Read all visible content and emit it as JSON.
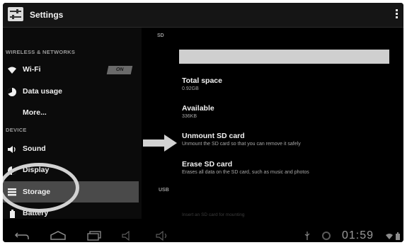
{
  "app": {
    "title": "Settings"
  },
  "left_panel": {
    "sections": {
      "wireless": "WIRELESS & NETWORKS",
      "device": "DEVICE"
    },
    "items": [
      {
        "label": "Wi-Fi",
        "toggle": "ON"
      },
      {
        "label": "Data usage"
      },
      {
        "label": "More..."
      },
      {
        "label": "Sound"
      },
      {
        "label": "Display"
      },
      {
        "label": "Storage",
        "selected": true
      },
      {
        "label": "Battery"
      }
    ]
  },
  "right_panel": {
    "sd_header": "SD",
    "usb_header": "USB",
    "total_space": {
      "title": "Total space",
      "value": "0.92GB"
    },
    "available": {
      "title": "Available",
      "value": "336KB"
    },
    "unmount": {
      "title": "Unmount SD card",
      "summary": "Unmount the SD card so that you can remove it safely"
    },
    "erase": {
      "title": "Erase SD card",
      "summary": "Erases all data on the SD card, such as music and photos"
    },
    "insert_hint": "Insert an SD card for mounting"
  },
  "status_bar": {
    "time": "01:59"
  },
  "colors": {
    "selected_row": "#4a4a4a",
    "annotation": "#d2d2d2",
    "background": "#000000"
  }
}
